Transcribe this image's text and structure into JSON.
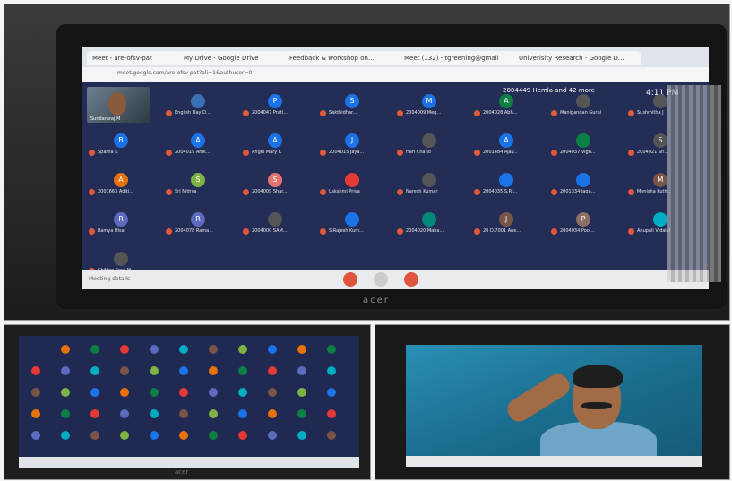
{
  "top_photo": {
    "tabs": [
      "Meet - are-ofsv-pat",
      "My Drive - Google Drive",
      "Feedback & workshop on...",
      "Meet (132) - tgreening@gmail",
      "Univerisity Research - Google D..."
    ],
    "url": "meet.google.com/are-ofsv-pat?pli=1&authuser=0",
    "self_name": "Sundararaj M",
    "more_text": "2004449 Hemla and 42 more",
    "clock": "4:11 PM",
    "participants": [
      {
        "initial": "",
        "name": "English Day D...",
        "color": "#3b6fb6"
      },
      {
        "initial": "P",
        "name": "2004047 Prati...",
        "color": "#1a73e8"
      },
      {
        "initial": "S",
        "name": "Sakthidhar...",
        "color": "#1a73e8"
      },
      {
        "initial": "M",
        "name": "2004009 Meg...",
        "color": "#1a73e8"
      },
      {
        "initial": "A",
        "name": "2004028 Abh...",
        "color": "#0b8043"
      },
      {
        "initial": "",
        "name": "Manigandan Gurul",
        "color": "#555"
      },
      {
        "initial": "",
        "name": "Sushmitha J",
        "color": "#555"
      },
      {
        "initial": "B",
        "name": "Sparna K",
        "color": "#1a73e8"
      },
      {
        "initial": "A",
        "name": "2004019 Anik...",
        "color": "#1a73e8"
      },
      {
        "initial": "A",
        "name": "Angel Mary K",
        "color": "#1a73e8"
      },
      {
        "initial": "J",
        "name": "2004015 Jaya...",
        "color": "#1a73e8"
      },
      {
        "initial": "",
        "name": "Hari Chand",
        "color": "#555"
      },
      {
        "initial": "A",
        "name": "2001484 Ajay...",
        "color": "#1a73e8"
      },
      {
        "initial": "",
        "name": "2004037 Vign...",
        "color": "#0b8043"
      },
      {
        "initial": "S",
        "name": "2004021 Sri...",
        "color": "#555"
      },
      {
        "initial": "A",
        "name": "2001663 Aditi...",
        "color": "#e8710a"
      },
      {
        "initial": "S",
        "name": "Sri Nithya",
        "color": "#7cb342"
      },
      {
        "initial": "S",
        "name": "2004009 Shar...",
        "color": "#e57373"
      },
      {
        "initial": "",
        "name": "Lakshmi Priya",
        "color": "#e53935"
      },
      {
        "initial": "",
        "name": "Naresh Kumar",
        "color": "#555"
      },
      {
        "initial": "",
        "name": "2004035 S.Ri...",
        "color": "#1a73e8"
      },
      {
        "initial": "",
        "name": "2001334 Jaga...",
        "color": "#1a73e8"
      },
      {
        "initial": "M",
        "name": "Monisha Kuth...",
        "color": "#795548"
      },
      {
        "initial": "R",
        "name": "Ramya Hisai",
        "color": "#5c6bc0"
      },
      {
        "initial": "R",
        "name": "2004078 Rama...",
        "color": "#5c6bc0"
      },
      {
        "initial": "",
        "name": "2004000 SAM...",
        "color": "#555"
      },
      {
        "initial": "",
        "name": "S.Rajesh Kum...",
        "color": "#1a73e8"
      },
      {
        "initial": "",
        "name": "2004020 Maha...",
        "color": "#00897b"
      },
      {
        "initial": "J",
        "name": "20 D.7001 Ane...",
        "color": "#795548"
      },
      {
        "initial": "P",
        "name": "2004034 Pooj...",
        "color": "#8d6e63"
      },
      {
        "initial": "",
        "name": "Anupali Vidalyi",
        "color": "#00acc1"
      },
      {
        "initial": "",
        "name": "Chithra Sree M",
        "color": "#555"
      }
    ],
    "meeting_details": "Meeting details",
    "brand": "acer"
  },
  "bottom_left_photo": {
    "brand": "acer"
  }
}
